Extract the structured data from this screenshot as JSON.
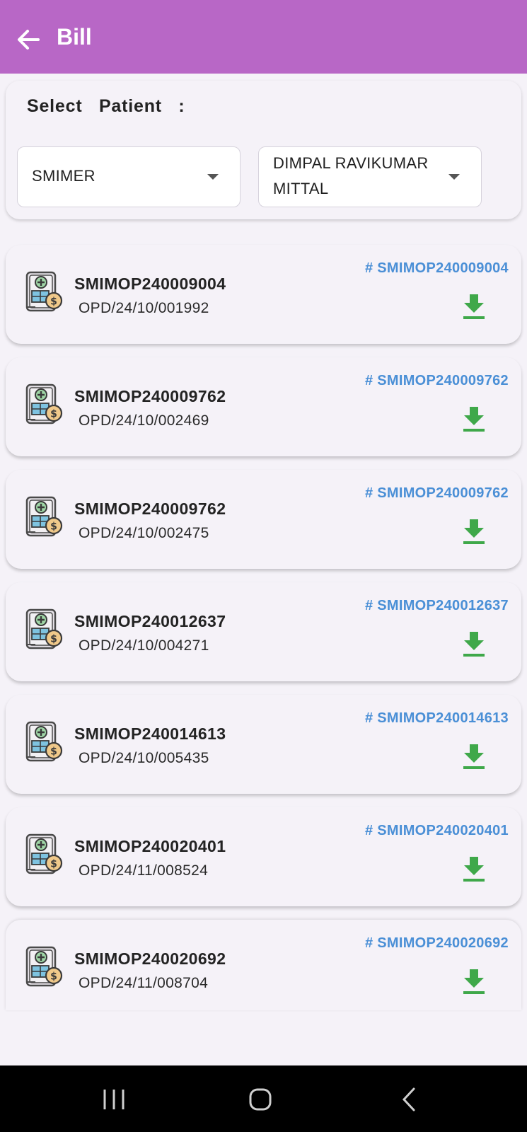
{
  "appbar": {
    "title": "Bill",
    "color": "#b867c6"
  },
  "patient_select": {
    "label": "Select  Patient  :",
    "hospital": "SMIMER",
    "patient_line1": "DIMPAL RAVIKUMAR",
    "patient_line2": "MITTAL"
  },
  "bills": [
    {
      "code": "SMIMOP240009004",
      "opd": "OPD/24/10/001992",
      "ref": "#  SMIMOP240009004"
    },
    {
      "code": "SMIMOP240009762",
      "opd": "OPD/24/10/002469",
      "ref": "#  SMIMOP240009762"
    },
    {
      "code": "SMIMOP240009762",
      "opd": "OPD/24/10/002475",
      "ref": "#  SMIMOP240009762"
    },
    {
      "code": "SMIMOP240012637",
      "opd": "OPD/24/10/004271",
      "ref": "#  SMIMOP240012637"
    },
    {
      "code": "SMIMOP240014613",
      "opd": "OPD/24/10/005435",
      "ref": "#  SMIMOP240014613"
    },
    {
      "code": "SMIMOP240020401",
      "opd": "OPD/24/11/008524",
      "ref": "#  SMIMOP240020401"
    },
    {
      "code": "SMIMOP240020692",
      "opd": "OPD/24/11/008704",
      "ref": "#  SMIMOP240020692"
    }
  ],
  "icons": {
    "back": "arrow-left-icon",
    "dropdown": "caret-down-icon",
    "bill": "medical-bill-icon",
    "download": "download-icon",
    "nav_recents": "recents-icon",
    "nav_home": "home-icon",
    "nav_back": "chevron-left-icon"
  },
  "colors": {
    "ref_text": "#4a8fd6",
    "download": "#3fa84a",
    "background": "#f5f2f8"
  }
}
